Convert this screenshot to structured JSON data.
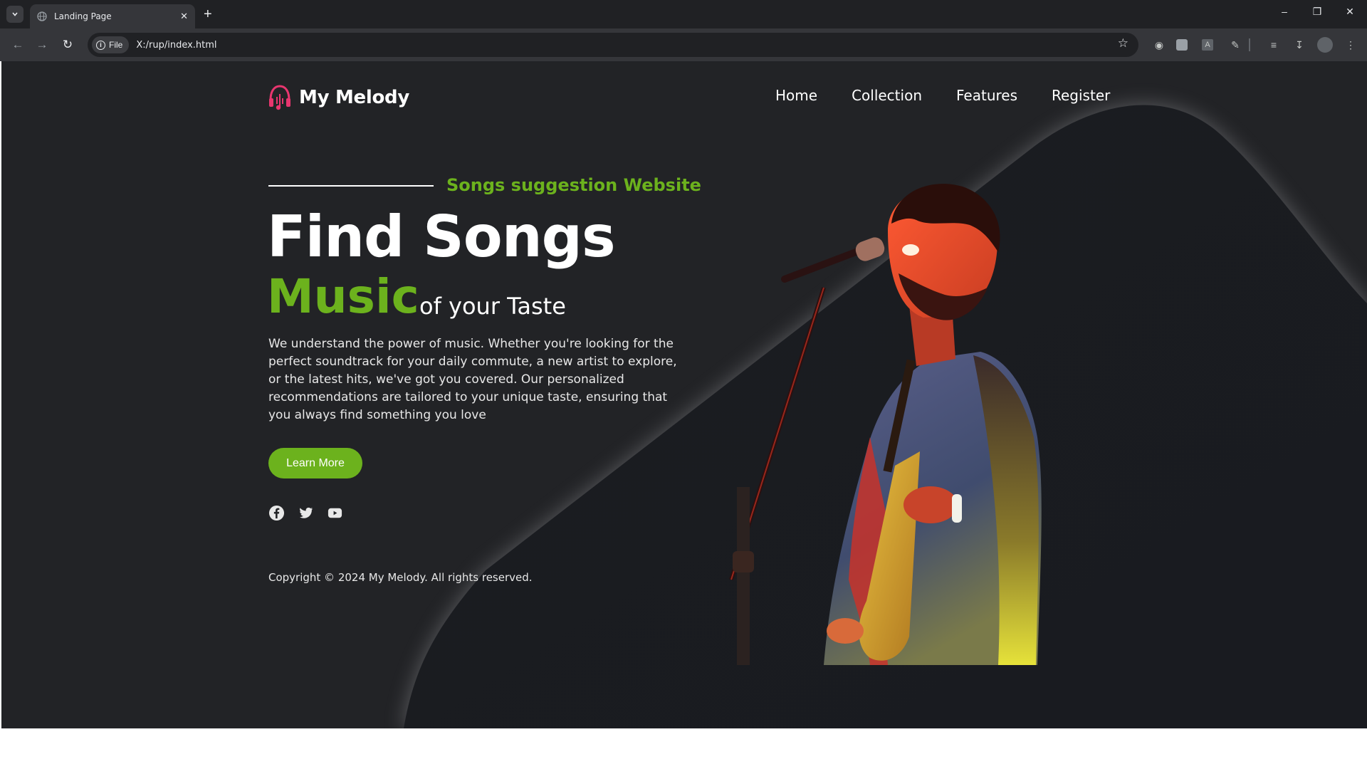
{
  "browser": {
    "tab_title": "Landing Page",
    "tab_close": "✕",
    "new_tab": "+",
    "window": {
      "minimize": "–",
      "restore": "❐",
      "close": "✕"
    },
    "site_chip": "File",
    "url": "X:/rup/index.html"
  },
  "site": {
    "brand": "My Melody",
    "nav": [
      "Home",
      "Collection",
      "Features",
      "Register"
    ]
  },
  "hero": {
    "subtitle": "Songs suggestion Website",
    "title": "Find Songs",
    "highlight": "Music",
    "highlight_suffix": "of your Taste",
    "description": "We understand the power of music. Whether you're looking for the perfect soundtrack for your daily commute, a new artist to explore, or the latest hits, we've got you covered. Our personalized recommendations are tailored to your unique taste, ensuring that you always find something you love",
    "cta": "Learn More",
    "socials": [
      "facebook-icon",
      "twitter-icon",
      "youtube-icon"
    ],
    "copyright": "Copyright © 2024 My Melody. All rights reserved."
  },
  "colors": {
    "accent": "#6cb21d",
    "background": "#222326",
    "logo": "#e8366f"
  }
}
